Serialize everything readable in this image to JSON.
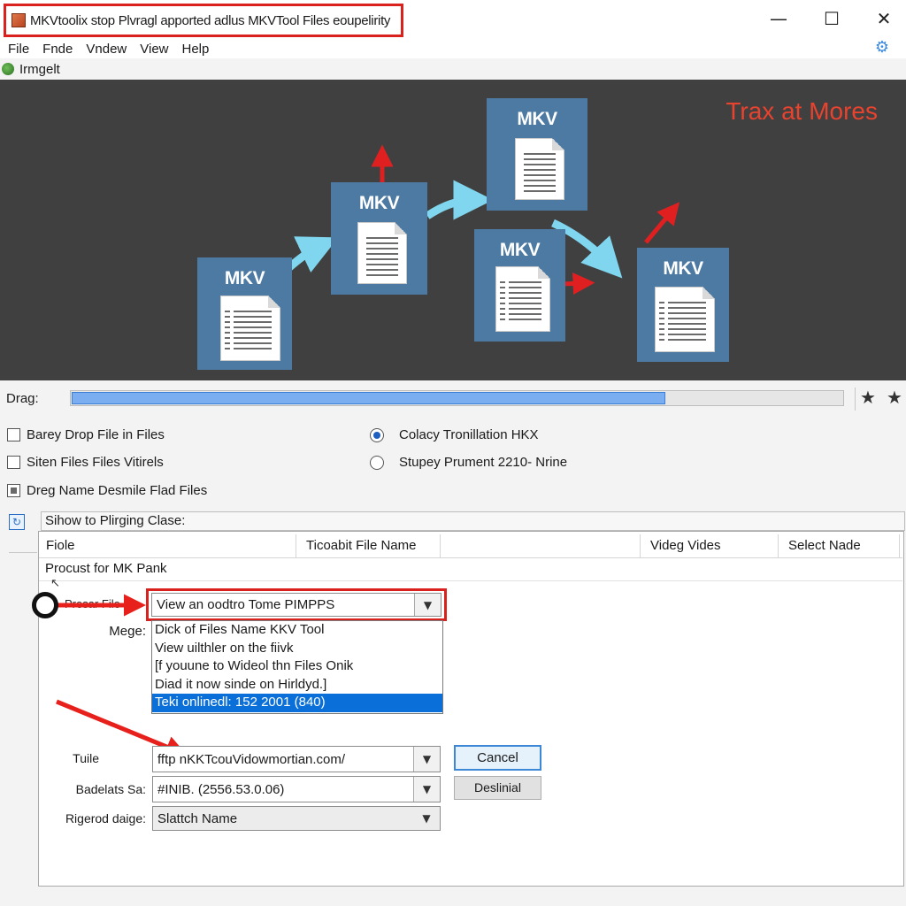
{
  "window": {
    "title": "MKVtoolix stop Plvragl apported adlus MKVTool Files eoupelirity",
    "controls": [
      "—",
      "☐",
      "✕"
    ]
  },
  "menu": [
    "File",
    "Fnde",
    "Vndew",
    "View",
    "Help"
  ],
  "toolbar": {
    "label": "Irmgelt"
  },
  "banner": {
    "caption": "Trax at Mores",
    "tile_label": "MKV"
  },
  "progress": {
    "label": "Drag:",
    "fraction": 0.77
  },
  "options": {
    "checkboxes": [
      {
        "label": "Barey Drop File in Files",
        "checked": false
      },
      {
        "label": "Siten Files Files Vitirels",
        "checked": false
      },
      {
        "label": "Dreg Name Desmile Flad Files",
        "checked": "partial"
      }
    ],
    "radios": [
      {
        "label": "Colacy Tronillation HKX",
        "selected": true
      },
      {
        "label": "Stupey Prument 2210- Nrine",
        "selected": false
      }
    ]
  },
  "panel": {
    "title": "Sihow to Plirging Clase:",
    "columns": [
      "Fiole",
      "Ticoabit File Name",
      "",
      "Videg Vides",
      "Select Nade"
    ],
    "row_text": "Procust for MK Pank",
    "preset_label": "Presar File",
    "merge_label": "Mege:",
    "combo_value": "View an oodtro Tome PIMPPS",
    "dropdown_items": [
      "Dick of Files Name KKV Tool",
      "View uilthler on the fiivk",
      "[f youune to Wideol thn Files Onik",
      "Diad it now sinde on Hirldyd.]",
      "Teki onlinedl: 152 2001 (840)"
    ],
    "dropdown_selected_index": 4,
    "fields": [
      {
        "label": "Tuile",
        "value": "fftp nKKTcouVidowmortian.com/"
      },
      {
        "label": "Badelats Sa:",
        "value": "#INIB.  (2556.53.0.06)"
      },
      {
        "label": "Rigerod daige:",
        "value": "Slattch Name"
      }
    ],
    "buttons": {
      "cancel": "Cancel",
      "secondary": "Deslinial"
    }
  },
  "colors": {
    "accent_red": "#d9211d",
    "tile_blue": "#4d7aa2",
    "banner_bg": "#404040",
    "arrow_cyan": "#7fd6ee",
    "selection_blue": "#0a6fd8",
    "progress_fill": "#7aaef0"
  },
  "icons": {
    "app": "app-icon",
    "settings": "gear-icon",
    "toolbar": "image-icon",
    "favorites": "star-icon",
    "panel": "refresh-icon",
    "combo_arrow": "chevron-down-icon"
  }
}
